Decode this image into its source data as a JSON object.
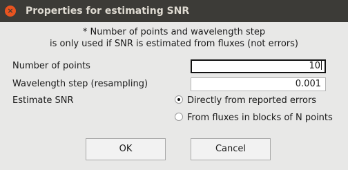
{
  "window": {
    "title": "Properties for estimating SNR",
    "close_glyph": "×"
  },
  "note": {
    "line1": "* Number of points and wavelength step",
    "line2": "is only used if SNR is estimated from fluxes (not errors)"
  },
  "form": {
    "points_label": "Number of points",
    "points_value": "10",
    "wavestep_label": "Wavelength step (resampling)",
    "wavestep_value": "0.001",
    "estimate_label": "Estimate SNR",
    "options": [
      {
        "label": "Directly from reported errors",
        "selected": true
      },
      {
        "label": "From fluxes in blocks of N points",
        "selected": false
      }
    ]
  },
  "buttons": {
    "ok_label": "OK",
    "cancel_label": "Cancel"
  },
  "colors": {
    "titlebar": "#3c3b37",
    "close_button": "#e95420",
    "background": "#e8e8e7"
  }
}
